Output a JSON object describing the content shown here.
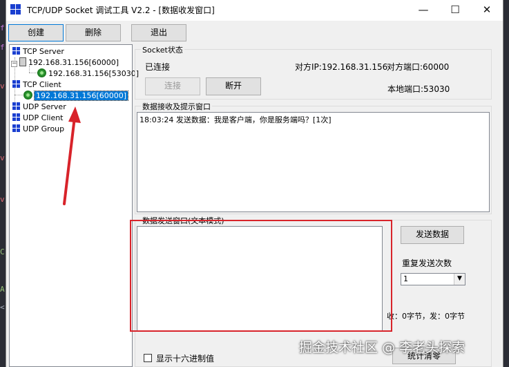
{
  "window": {
    "title": "TCP/UDP Socket 调试工具 V2.2 - [数据收发窗口]",
    "minimize": "—",
    "maximize": "☐",
    "close": "✕"
  },
  "toolbar": {
    "create": "创建",
    "delete": "删除",
    "exit": "退出"
  },
  "tree": {
    "tcp_server": "TCP Server",
    "server_node": "192.168.31.156[60000]",
    "server_child": "192.168.31.156[53030]",
    "tcp_client": "TCP Client",
    "client_node": "192.168.31.156[60000]",
    "udp_server": "UDP Server",
    "udp_client": "UDP Client",
    "udp_group": "UDP Group",
    "expander": "−"
  },
  "socket": {
    "group_title": "Socket状态",
    "status": "已连接",
    "remote_ip": "对方IP:192.168.31.156",
    "remote_port": "对方端口:60000",
    "local_port": "本地端口:53030",
    "connect_button": "连接",
    "disconnect_button": "断开"
  },
  "receive": {
    "group_title": "数据接收及提示窗口",
    "content": "18:03:24 发送数据：我是客户端，你是服务端吗？[1次]"
  },
  "send": {
    "group_title": "数据发送窗口(文本模式)",
    "content": "",
    "send_button": "发送数据",
    "repeat_label": "重复发送次数",
    "repeat_value": "1",
    "counter": "收：0字节，发：0字节",
    "hex_checkbox_label": "显示十六进制值",
    "reset_button": "统计清零"
  },
  "desktop_glyphs": [
    "f",
    "f",
    "v",
    "C",
    "A",
    "<",
    "v",
    "v"
  ],
  "colors": {
    "accent": "#0078d7",
    "annotation": "#d8232a",
    "tree_icon": "#1a3fd0",
    "globe": "#2f9a33"
  },
  "watermark": "掘金技术社区 @ 李老头探索"
}
